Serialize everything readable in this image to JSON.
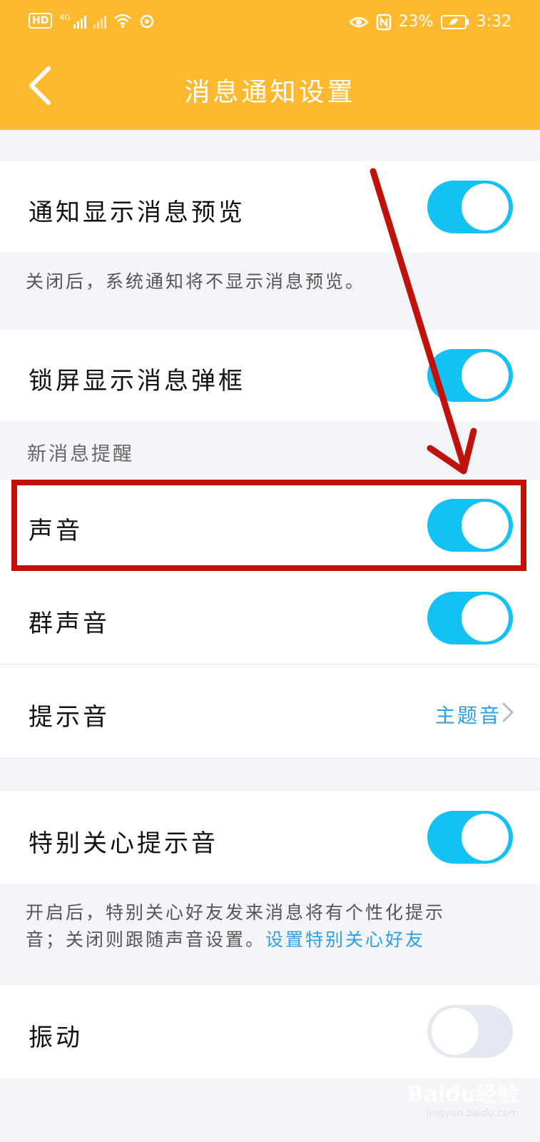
{
  "status_bar": {
    "hd": "HD",
    "network": "4G",
    "battery_percent": "23%",
    "time": "3:32"
  },
  "header": {
    "title": "消息通知设置"
  },
  "settings": {
    "preview": {
      "label": "通知显示消息预览",
      "on": true
    },
    "preview_hint": "关闭后，系统通知将不显示消息预览。",
    "lock_popup": {
      "label": "锁屏显示消息弹框",
      "on": true
    },
    "section_new_message": "新消息提醒",
    "sound": {
      "label": "声音",
      "on": true
    },
    "group_sound": {
      "label": "群声音",
      "on": true
    },
    "tone": {
      "label": "提示音",
      "value": "主题音"
    },
    "special_tone": {
      "label": "特别关心提示音",
      "on": true
    },
    "special_hint_line1": "开启后，特别关心好友发来消息将有个性化提示",
    "special_hint_line2": "音；关闭则跟随声音设置。",
    "special_hint_link": "设置特别关心好友",
    "vibrate": {
      "label": "振动",
      "on": false
    }
  },
  "watermark": {
    "brand": "Baidu经验",
    "url": "jingyan.baidu.com"
  },
  "colors": {
    "header": "#ffb92e",
    "toggle_on": "#12c2f5",
    "toggle_off": "#e4e8ef",
    "link": "#2d9ee8",
    "annotation": "#c0120b"
  }
}
